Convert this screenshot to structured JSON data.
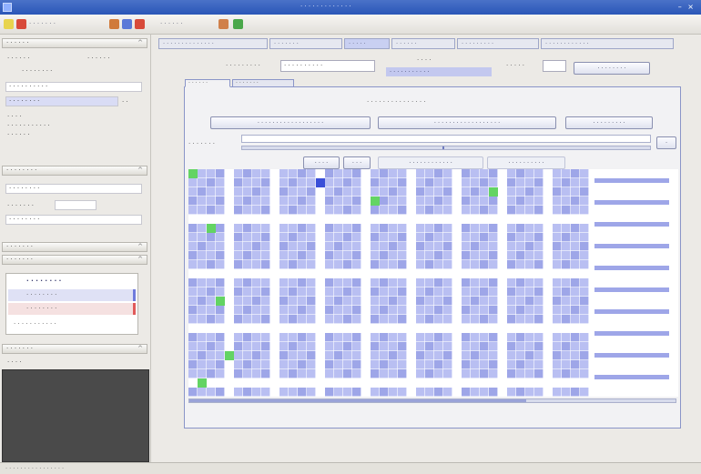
{
  "window": {
    "title": "· · · · · · · · · · · · ·"
  },
  "toolbar": {
    "file_label": "· · · · · · ·",
    "view_label": "· · · · · ·"
  },
  "left": {
    "nav_header": "· · · · · ·",
    "items": [
      {
        "label": "· · · · · ·",
        "value": "· · · · · ·"
      },
      {
        "label": "· · · · · · · ·",
        "value": ""
      }
    ],
    "selected_field": "· · · · · · · · · ·",
    "highlight_field": "· · · · · · · ·",
    "highlight_suffix": "· ·",
    "small_lines": [
      "· · · ·",
      "· · · · · · · · · · ·",
      "· · · · · ·"
    ],
    "section2_header": "· · · · · · · ·",
    "section2_field1": "· · · · · · · ·",
    "section2_field2": "· · · · · · ·",
    "section2_field3": "· · · · · · · ·",
    "section3_header": "· · · · · · ·",
    "section4_header": "· · · · · · ·",
    "legend_title": "· · · · · · · ·",
    "legend_rows": [
      "· · · · · · · ·",
      "· · · · · · · ·",
      "· · · · · · · · · · ·"
    ],
    "legend_colors": [
      "#6f7bdc",
      "#e05a5a"
    ],
    "section5_header": "· · · · · · ·",
    "section5_sub": "· · · ·"
  },
  "main": {
    "tabs": [
      "· · · · · · · · · · · · · ·",
      "· · · · · · ·",
      "· · · · ·",
      "· · · · · ·",
      "· · · · · · · · ·",
      "· · · · · · · · · · · ·"
    ],
    "field_label": "· · · · · · · · ·",
    "field_value": "· · · · · · · · · ·",
    "chip_top": "· · · ·",
    "chip_text": "· · · · · · · · · · ·",
    "right_label": "· · · · ·",
    "right_button": "· · · · · · · ·",
    "subtabs": [
      "· · · · · ·",
      "· · · · · · ·"
    ],
    "info_line": "· · · · · · · · · · · · · · ·",
    "btn1": "· · · · · · · · · · · · · · · · · ·",
    "btn2": "· · · · · · · · · · · · · · · · · ·",
    "btn3": "· · · · · · · · ·",
    "row_label": "· · · · · · ·",
    "small_btn1": "· · · ·",
    "small_btn2": "· · ·",
    "small_btn3": "· · · · · · · · · · · ·",
    "small_btn4": "· · · · · · · · · ·",
    "heatmap_colors": {
      "cell": "#b9bff2",
      "cell_alt": "#9ea6e8",
      "line": "#ffffff",
      "accent_green": "#63d463",
      "accent_blue": "#3a4fd8"
    }
  },
  "status": {
    "text": "· · · · · · · · · · · · · · · ·"
  }
}
